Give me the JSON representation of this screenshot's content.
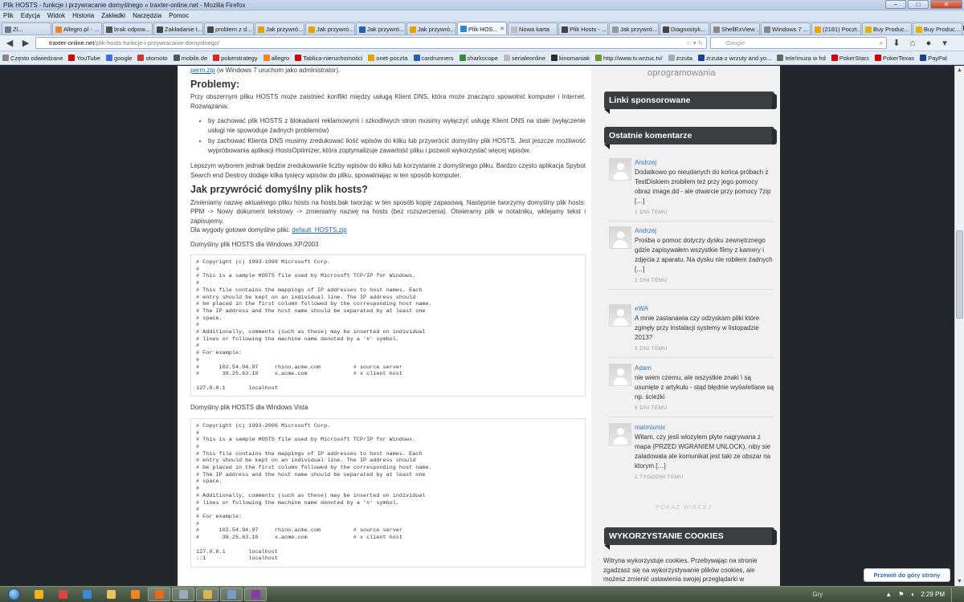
{
  "window": {
    "title": "Plik HOSTS - funkcje i przywracanie domyślnego » traxter-online.net - Mozilla Firefox"
  },
  "menu": [
    "Plik",
    "Edycja",
    "Widok",
    "Historia",
    "Zakładki",
    "Narzędzia",
    "Pomoc"
  ],
  "tabs": [
    {
      "label": "Zl...",
      "color": "#6a7a8a"
    },
    {
      "label": "Allegro.pl - ...",
      "color": "#f58220"
    },
    {
      "label": "brak odpow...",
      "color": "#555"
    },
    {
      "label": "Zakładanie t...",
      "color": "#444"
    },
    {
      "label": "problem z d...",
      "color": "#444"
    },
    {
      "label": "Jak przywró...",
      "color": "#e8a000"
    },
    {
      "label": "Jak przywró...",
      "color": "#e8a000"
    },
    {
      "label": "Jak przywró...",
      "color": "#2a5fb0"
    },
    {
      "label": "Jak przywró...",
      "color": "#e8a000"
    },
    {
      "label": "Plik HOS...",
      "color": "#2a8ad8",
      "active": true
    },
    {
      "label": "Nowa karta",
      "color": "#bbb"
    },
    {
      "label": "Plik Hosts - ...",
      "color": "#444"
    },
    {
      "label": "Jak przywró...",
      "color": "#999"
    },
    {
      "label": "Diagnostyk...",
      "color": "#444"
    },
    {
      "label": "ShellExView ...",
      "color": "#888"
    },
    {
      "label": "Windows 7 ...",
      "color": "#888"
    },
    {
      "label": "(2181) Poczt...",
      "color": "#f5a000"
    },
    {
      "label": "Buy Produc...",
      "color": "#e2b400"
    },
    {
      "label": "Buy Produc...",
      "color": "#e2b400"
    }
  ],
  "nav": {
    "url_host": "traxter-online.net",
    "url_path": "/plik-hosts-funkcje-i-przywracanie-domyslnego/",
    "search_placeholder": "Google"
  },
  "bookmarks": [
    {
      "label": "Często odwiedzane",
      "color": "#888"
    },
    {
      "label": "YouTube",
      "color": "#d00"
    },
    {
      "label": "google",
      "color": "#3a6fd8"
    },
    {
      "label": "otomoto",
      "color": "#c33"
    },
    {
      "label": "mobile.de",
      "color": "#555"
    },
    {
      "label": "pokerstrategy",
      "color": "#d22"
    },
    {
      "label": "allegro",
      "color": "#f58220"
    },
    {
      "label": "Tablica-nieruchomości",
      "color": "#c00"
    },
    {
      "label": "onet-poczta",
      "color": "#e0a400"
    },
    {
      "label": "cardrunners",
      "color": "#2a5fb0"
    },
    {
      "label": "sharkscope",
      "color": "#3a8a3a"
    },
    {
      "label": "serialeonline",
      "color": "#bbb"
    },
    {
      "label": "kinomaniak",
      "color": "#2a2a2a"
    },
    {
      "label": "http://www.tv.wrzuc.tv/",
      "color": "#6a9a2a"
    },
    {
      "label": "zrzuta",
      "color": "#aaa"
    },
    {
      "label": "zrzuta-z wrzuty and yo...",
      "color": "#1f3f8a"
    },
    {
      "label": "tele/muza w hd",
      "color": "#666"
    },
    {
      "label": "PokerStars",
      "color": "#c00"
    },
    {
      "label": "PokerTexas",
      "color": "#c00"
    },
    {
      "label": "PayPal",
      "color": "#1f3f8a"
    }
  ],
  "article": {
    "intro_link": "perm.zip",
    "intro_text": " (w Windows 7 uruchom jako administrator).",
    "h_problems": "Problemy:",
    "p_problems": "Przy obszernym pliku HOSTS może zaistnieć konflikt między usługą Klient DNS, która może znacząco spowolnić komputer i Internet. Rozwiązania:",
    "bullets": [
      "by zachować plik HOSTS z blokadami reklamowymi i szkodliwych stron musimy wyłączyć usługę Klient DNS na stałe (wyłączenie usługi nie spowoduje żadnych problemów)",
      "by zachować Klienta DNS musimy zredukować ilość wpisów do kilku lub przywrócić domyślny plik HOSTS. Jest jeszcze możliwość wypróbowania aplikacji HostsOptimizer, która zoptymalizuje zawartość pliku i pozwoli wykorzystać więcej wpisów."
    ],
    "p_better": "Lepszym wyborem jednak będzie zredukowanie liczby wpisów do kilku lub korzystanie z domyślnego pliku. Bardzo często aplikacja Spybot Search end Destroy dodaje kilka tysięcy wpisów do pliku, spowalniając w ten sposób komputer.",
    "h_restore": "Jak przywrócić domyślny plik hosts?",
    "p_restore": "Zmieniamy nazwę aktualnego pliku hosts na hosts.bak tworząc w ten sposób kopię zapasową. Następnie tworzymy domyślny plik hosts: PPM -> Nowy dokument tekstowy -> zmieniamy nazwę na hosts (bez rozszerzenia). Otwieramy plik w notatniku, wklejamy tekst i zapisujemy.",
    "p_download_prefix": "Dla wygody gotowe domyślne pliki: ",
    "p_download_link": "default_HOSTS.zip",
    "label_xp": "Domyślny plik HOSTS dla Windows XP/2003",
    "code_xp": "# Copyright (c) 1993-1999 Microsoft Corp.\n#\n# This is a sample HOSTS file used by Microsoft TCP/IP for Windows.\n#\n# This file contains the mappings of IP addresses to host names. Each\n# entry should be kept on an individual line. The IP address should\n# be placed in the first column followed by the corresponding host name.\n# The IP address and the host name should be separated by at least one\n# space.\n#\n# Additionally, comments (such as these) may be inserted on individual\n# lines or following the machine name denoted by a '#' symbol.\n#\n# For example:\n#\n#      102.54.94.97     rhino.acme.com          # source server\n#       38.25.63.10     x.acme.com              # x client host\n\n127.0.0.1       localhost",
    "label_vista": "Domyślny plik HOSTS dla Windows Vista",
    "code_vista": "# Copyright (c) 1993-2006 Microsoft Corp.\n#\n# This is a sample HOSTS file used by Microsoft TCP/IP for Windows.\n#\n# This file contains the mappings of IP addresses to host names. Each\n# entry should be kept on an individual line. The IP address should\n# be placed in the first column followed by the corresponding host name.\n# The IP address and the host name should be separated by at least one\n# space.\n#\n# Additionally, comments (such as these) may be inserted on individual\n# lines or following the machine name denoted by a '#' symbol.\n#\n# For example:\n#\n#      102.54.94.97     rhino.acme.com          # source server\n#       38.25.63.10     x.acme.com              # x client host\n\n127.0.0.1       localhost\n::1             localhost"
  },
  "sidebar": {
    "software_fragment": "oprogramowania",
    "sponsored_title": "Linki sponsorowane",
    "comments_title": "Ostatnie komentarze",
    "comments": [
      {
        "author": "Andrzej",
        "text": "Dodatkowo po nieudanych do końca próbach z TestDiskiem zrobiłem też przy jego pomocy obraz image.dd - ale otwarcie przy pomocy 7zip […]",
        "when": "1 DNI TEMU"
      },
      {
        "author": "Andrzej",
        "text": "Prośba o pomoc dotyczy dysku zewnętrznego gdzie zapisywałem wszystkie filmy z kamery i zdjęcia z aparatu. Na dysku nie robiłem żadnych […]",
        "when": "1 DNI TEMU"
      },
      {
        "author": "eWA",
        "text": "A mnie zastanawia czy odzyskam pliki które zginęły przy instalacji systemy w listopadzie 2013?",
        "when": "3 DNI TEMU"
      },
      {
        "author": "Adam",
        "text": "nie wiem czemu, ale wszystkie znaki \\ są usunięte z artykułu - stąd błędnie wyświetlane są np. ścieżki",
        "when": "5 DNI TEMU"
      },
      {
        "author": "matmixmix",
        "text": "Witam, czy jesli wlozylem plyte nagrywana z mapa (PRZED WGRANIEM UNLOCK), niby sie zaladowala ale komunikat jest taki ze obszar na ktorym […]",
        "when": "1 TYGODNI TEMU"
      }
    ],
    "more_label": "POKAŻ WIĘCEJ",
    "cookies_title": "WYKORZYSTANIE COOKIES",
    "cookies_text": "Witryna wykorzystuje cookies. Przebywając na stronie zgadzasz się na wykorzystywanie plików cookies, ale możesz zmienić ustawienia swojej przeglądarki w zakresie cookies lub całkowicie"
  },
  "back_to_top": "Przewiń do góry strony",
  "taskbar": {
    "tray_label": "Gry",
    "clock": "2:29 PM",
    "apps": [
      {
        "name": "gg-icon",
        "color": "#f3b21a",
        "open": false
      },
      {
        "name": "chrome-icon",
        "color": "#d44",
        "open": false
      },
      {
        "name": "ie-icon",
        "color": "#3a8ad8",
        "open": false
      },
      {
        "name": "explorer-icon",
        "color": "#e8c25a",
        "open": false
      },
      {
        "name": "media-player-icon",
        "color": "#f58220",
        "open": false
      },
      {
        "name": "firefox-icon",
        "color": "#e66a1a",
        "open": true
      },
      {
        "name": "unknown-icon",
        "color": "#9ab",
        "open": true
      },
      {
        "name": "folder-icon",
        "color": "#d8b650",
        "open": true
      },
      {
        "name": "network-icon",
        "color": "#7c9ac8",
        "open": true
      },
      {
        "name": "winrar-icon",
        "color": "#8a3aa8",
        "open": true
      }
    ]
  }
}
